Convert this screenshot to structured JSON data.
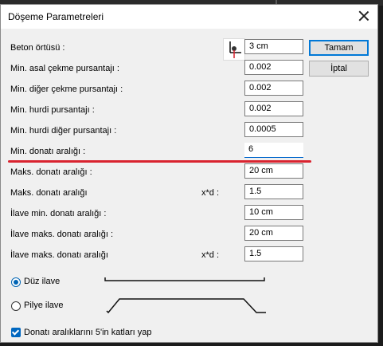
{
  "dialog": {
    "title": "Döşeme Parametreleri"
  },
  "buttons": {
    "ok": "Tamam",
    "cancel": "İptal"
  },
  "rows": [
    {
      "label": "Beton örtüsü :",
      "value": "3 cm"
    },
    {
      "label": "Min. asal çekme pursantajı :",
      "value": "0.002"
    },
    {
      "label": "Min. diğer çekme pursantajı :",
      "value": "0.002"
    },
    {
      "label": "Min. hurdi pursantajı :",
      "value": "0.002"
    },
    {
      "label": "Min. hurdi diğer pursantajı :",
      "value": "0.0005"
    },
    {
      "label": "Min. donatı aralığı :",
      "value": "6"
    },
    {
      "label": "Maks. donatı aralığı :",
      "value": "20 cm"
    },
    {
      "label": "Maks. donatı aralığı",
      "suffix": "x*d :",
      "value": "1.5"
    },
    {
      "label": "İlave min. donatı aralığı  :",
      "value": "10 cm"
    },
    {
      "label": "İlave maks. donatı aralığı :",
      "value": "20 cm"
    },
    {
      "label": "İlave maks. donatı aralığı",
      "suffix": "x*d :",
      "value": "1.5"
    }
  ],
  "options": {
    "duz_ilave": {
      "label": "Düz ilave",
      "selected": true
    },
    "pilye_ilave": {
      "label": "Pilye ilave",
      "selected": false
    },
    "round_5": {
      "label": "Donatı aralıklarını 5'in katları yap",
      "checked": true
    }
  },
  "colors": {
    "highlight": "#d9232f",
    "accent": "#0067c0"
  }
}
